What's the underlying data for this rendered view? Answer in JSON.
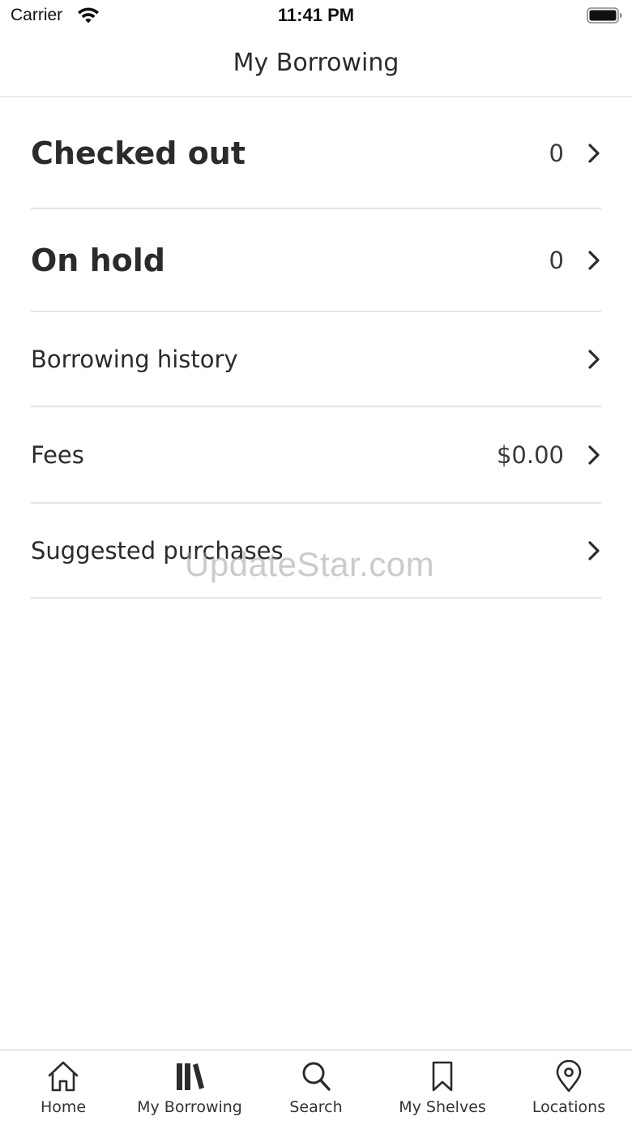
{
  "status_bar": {
    "carrier": "Carrier",
    "time": "11:41 PM",
    "icons": [
      "wifi-icon",
      "battery-icon"
    ]
  },
  "nav": {
    "title": "My Borrowing"
  },
  "rows": [
    {
      "label": "Checked out",
      "value": "0",
      "icon": "chevron-right-icon"
    },
    {
      "label": "On hold",
      "value": "0",
      "icon": "chevron-right-icon"
    },
    {
      "label": "Borrowing history",
      "icon": "chevron-right-icon"
    },
    {
      "label": "Fees",
      "value": "$0.00",
      "icon": "chevron-right-icon"
    },
    {
      "label": "Suggested purchases",
      "icon": "chevron-right-icon"
    }
  ],
  "watermark": "UpdateStar.com",
  "tabs": [
    {
      "label": "Home",
      "icon": "home-icon"
    },
    {
      "label": "My Borrowing",
      "icon": "books-icon"
    },
    {
      "label": "Search",
      "icon": "search-icon"
    },
    {
      "label": "My Shelves",
      "icon": "bookmark-icon"
    },
    {
      "label": "Locations",
      "icon": "location-pin-icon"
    }
  ]
}
